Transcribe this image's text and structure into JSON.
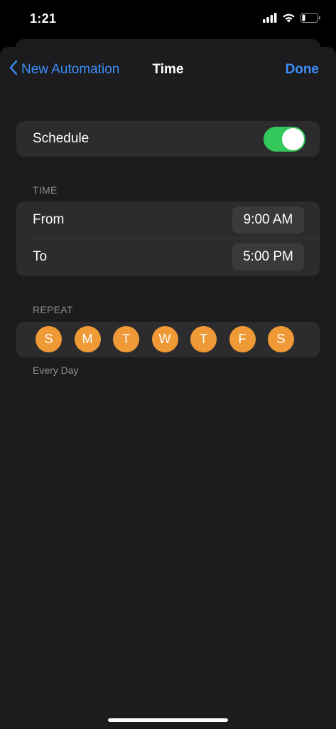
{
  "status_bar": {
    "time": "1:21"
  },
  "nav": {
    "back_label": "New Automation",
    "title": "Time",
    "done_label": "Done"
  },
  "schedule": {
    "label": "Schedule",
    "enabled": true
  },
  "time_section": {
    "header": "TIME",
    "from_label": "From",
    "from_value": "9:00 AM",
    "to_label": "To",
    "to_value": "5:00 PM"
  },
  "repeat_section": {
    "header": "REPEAT",
    "days": [
      "S",
      "M",
      "T",
      "W",
      "T",
      "F",
      "S"
    ],
    "summary": "Every Day"
  },
  "colors": {
    "accent_blue": "#3d8ef8",
    "toggle_on": "#34c759",
    "day_selected": "#f09a37"
  }
}
